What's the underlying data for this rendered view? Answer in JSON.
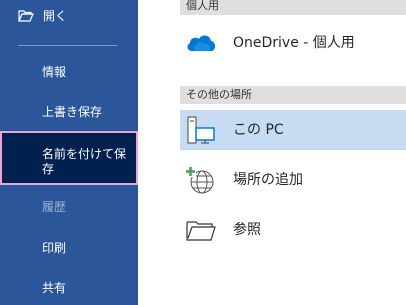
{
  "sidebar": {
    "open_label": "開く",
    "items": [
      {
        "label": "情報"
      },
      {
        "label": "上書き保存"
      },
      {
        "label": "名前を付けて保\n存"
      },
      {
        "label": "履歴"
      },
      {
        "label": "印刷"
      },
      {
        "label": "共有"
      }
    ]
  },
  "main": {
    "personal_header": "個人用",
    "onedrive_label": "OneDrive - 個人用",
    "other_header": "その他の場所",
    "this_pc_label": "この PC",
    "add_place_label": "場所の追加",
    "browse_label": "参照"
  },
  "colors": {
    "sidebar_bg": "#2b579a",
    "selected_bg": "#002050",
    "selected_border": "#e7a6d3",
    "selected_row": "#c7dcf3",
    "onedrive_blue": "#0078d4"
  }
}
